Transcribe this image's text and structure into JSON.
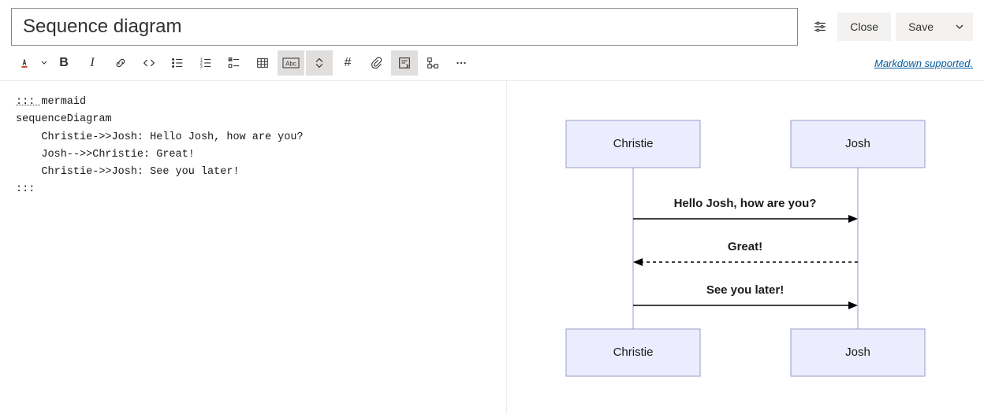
{
  "header": {
    "title_value": "Sequence diagram",
    "close_label": "Close",
    "save_label": "Save"
  },
  "toolbar": {
    "markdown_link": "Markdown supported."
  },
  "source": {
    "l1a": "::: ",
    "l1b": "mermaid",
    "l2": "sequenceDiagram",
    "l3": "    Christie->>Josh: Hello Josh, how are you?",
    "l4": "    Josh-->>Christie: Great!",
    "l5": "    Christie->>Josh: See you later!",
    "l6": ":::"
  },
  "diagram": {
    "participants": {
      "a": "Christie",
      "b": "Josh"
    },
    "messages": {
      "m1": "Hello Josh, how are you?",
      "m2": "Great!",
      "m3": "See you later!"
    }
  },
  "chart_data": {
    "type": "sequenceDiagram",
    "participants": [
      "Christie",
      "Josh"
    ],
    "messages": [
      {
        "from": "Christie",
        "to": "Josh",
        "text": "Hello Josh, how are you?",
        "style": "solid"
      },
      {
        "from": "Josh",
        "to": "Christie",
        "text": "Great!",
        "style": "dashed"
      },
      {
        "from": "Christie",
        "to": "Josh",
        "text": "See you later!",
        "style": "solid"
      }
    ]
  }
}
